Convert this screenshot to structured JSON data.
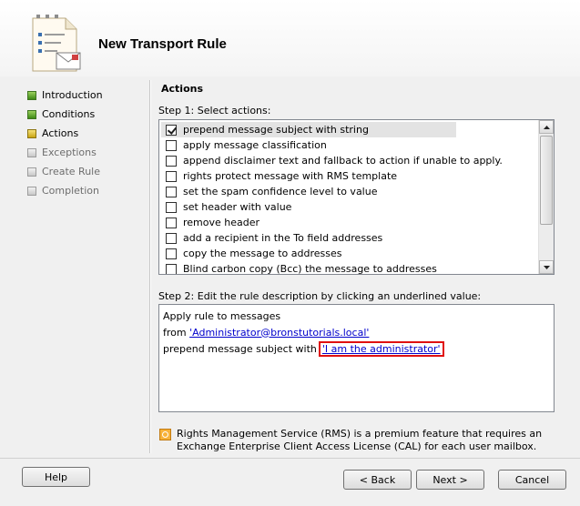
{
  "wizard": {
    "title": "New Transport Rule"
  },
  "nav": [
    {
      "label": "Introduction",
      "state": "done"
    },
    {
      "label": "Conditions",
      "state": "done"
    },
    {
      "label": "Actions",
      "state": "current"
    },
    {
      "label": "Exceptions",
      "state": "pending"
    },
    {
      "label": "Create Rule",
      "state": "pending"
    },
    {
      "label": "Completion",
      "state": "pending"
    }
  ],
  "page": {
    "section_title": "Actions",
    "step1_label": "Step 1: Select actions:",
    "step2_label": "Step 2: Edit the rule description by clicking an underlined value:"
  },
  "actions": [
    {
      "label": "prepend message subject with string",
      "checked": true
    },
    {
      "label": "apply message classification",
      "checked": false
    },
    {
      "label": "append disclaimer text and fallback to action if unable to apply.",
      "checked": false
    },
    {
      "label": "rights protect message with RMS template",
      "checked": false
    },
    {
      "label": "set the spam confidence level to value",
      "checked": false
    },
    {
      "label": "set header with value",
      "checked": false
    },
    {
      "label": "remove header",
      "checked": false
    },
    {
      "label": "add a recipient in the To field addresses",
      "checked": false
    },
    {
      "label": "copy the message to addresses",
      "checked": false
    },
    {
      "label": "Blind carbon copy (Bcc) the message to addresses",
      "checked": false
    }
  ],
  "description": {
    "line1": "Apply rule to messages",
    "line2_prefix": "from ",
    "line2_link": "'Administrator@bronstutorials.local'",
    "line3_prefix": "prepend message subject with",
    "line3_link": "'I am the administrator'"
  },
  "info": {
    "icon": "rms-info-icon",
    "text": "Rights Management Service (RMS) is a premium feature that requires an Exchange Enterprise Client Access License (CAL) for each user mailbox."
  },
  "buttons": {
    "help": "Help",
    "back": "< Back",
    "next": "Next >",
    "cancel": "Cancel"
  },
  "colors": {
    "done": "#3e8a16",
    "current": "#c9a414",
    "pending": "#c8c8c8",
    "highlight_box": "#e01010",
    "link": "#0000cc"
  }
}
